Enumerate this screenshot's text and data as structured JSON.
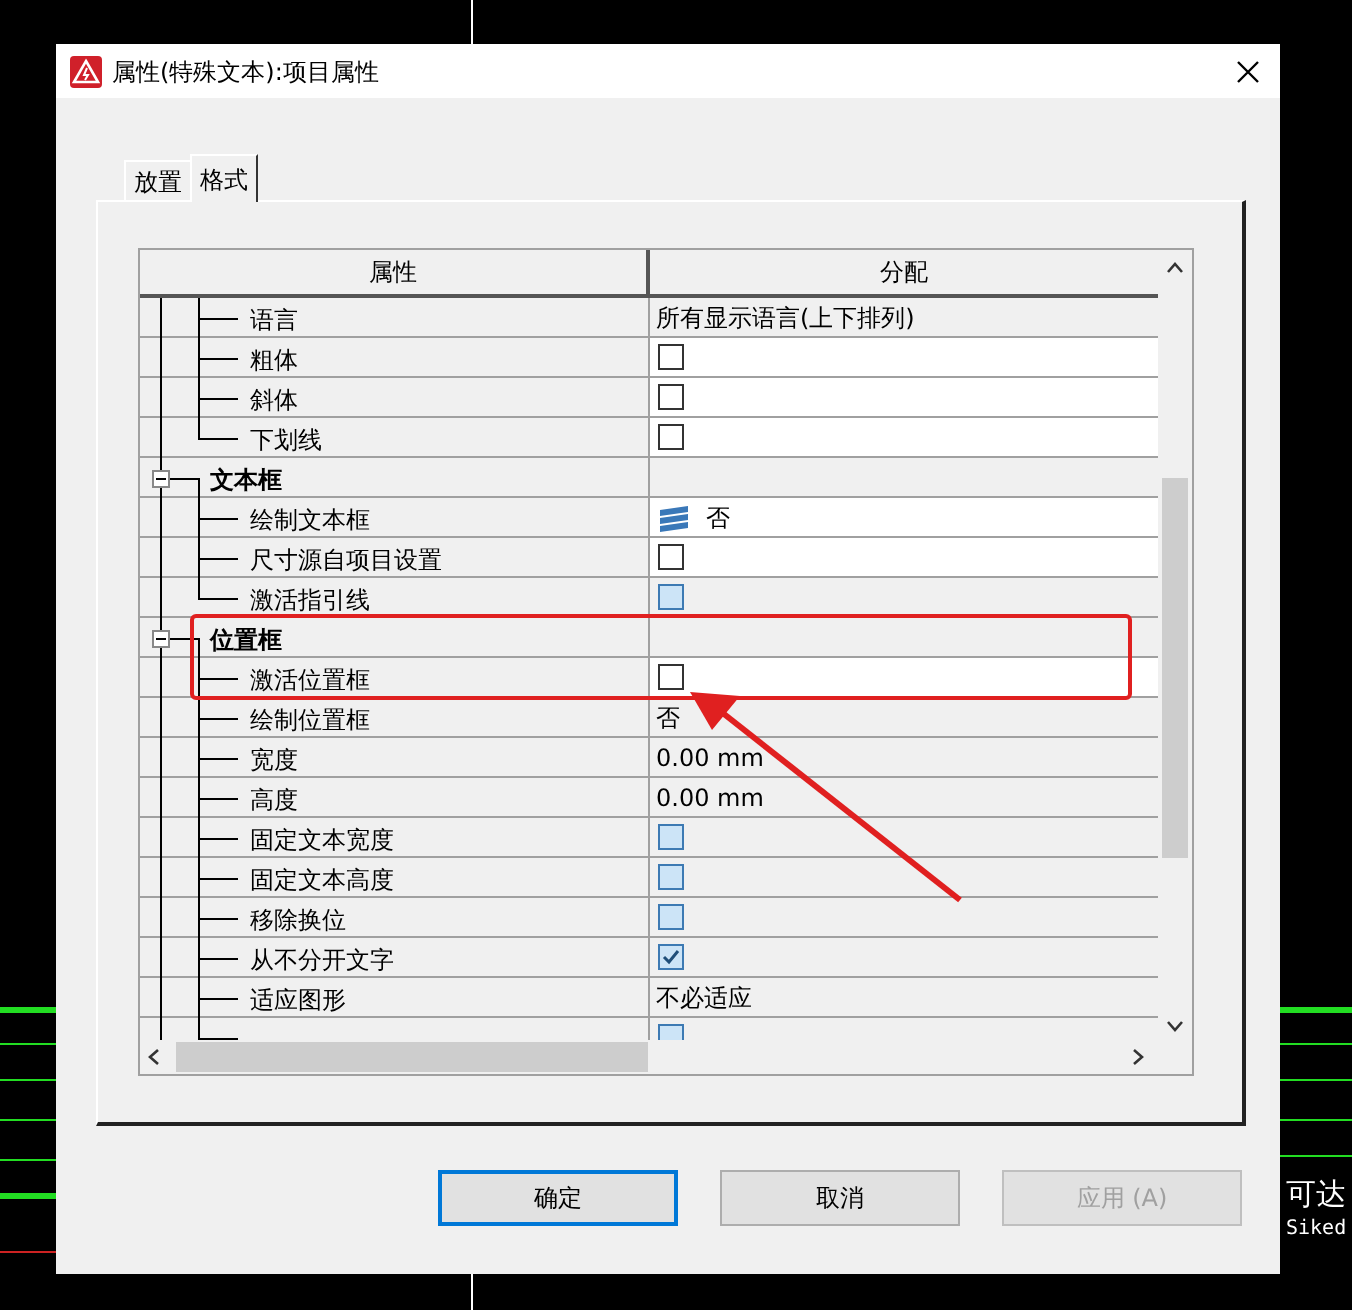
{
  "background": {
    "texts": [
      "可达",
      "Siked"
    ]
  },
  "window": {
    "title": "属性(特殊文本):项目属性"
  },
  "tabs": [
    {
      "label": "放置",
      "selected": false
    },
    {
      "label": "格式",
      "selected": true
    }
  ],
  "grid": {
    "columns": [
      "属性",
      "分配"
    ],
    "tree": [
      {
        "kind": "continued",
        "children": [
          {
            "label": "语言",
            "kind": "text",
            "value": "所有显示语言(上下排列)",
            "editable": false
          },
          {
            "label": "粗体",
            "kind": "checkbox",
            "checked": false,
            "editable": true
          },
          {
            "label": "斜体",
            "kind": "checkbox",
            "checked": false,
            "editable": true
          },
          {
            "label": "下划线",
            "kind": "checkbox",
            "checked": false,
            "editable": true
          }
        ]
      },
      {
        "kind": "group",
        "label": "文本框",
        "expanded": true,
        "children": [
          {
            "label": "绘制文本框",
            "kind": "icon_text",
            "value": "否",
            "editable": true
          },
          {
            "label": "尺寸源自项目设置",
            "kind": "checkbox",
            "checked": false,
            "editable": true
          },
          {
            "label": "激活指引线",
            "kind": "checkbox",
            "checked": false,
            "editable": false
          }
        ]
      },
      {
        "kind": "group",
        "label": "位置框",
        "expanded": true,
        "children": [
          {
            "label": "激活位置框",
            "kind": "checkbox",
            "checked": false,
            "editable": true
          },
          {
            "label": "绘制位置框",
            "kind": "text",
            "value": "否",
            "editable": false
          },
          {
            "label": "宽度",
            "kind": "text",
            "value": "0.00 mm",
            "editable": false
          },
          {
            "label": "高度",
            "kind": "text",
            "value": "0.00 mm",
            "editable": false
          },
          {
            "label": "固定文本宽度",
            "kind": "checkbox",
            "checked": false,
            "editable": false
          },
          {
            "label": "固定文本高度",
            "kind": "checkbox",
            "checked": false,
            "editable": false
          },
          {
            "label": "移除换位",
            "kind": "checkbox",
            "checked": false,
            "editable": false
          },
          {
            "label": "从不分开文字",
            "kind": "checkbox",
            "checked": true,
            "editable": false
          },
          {
            "label": "适应图形",
            "kind": "text",
            "value": "不必适应",
            "editable": false
          },
          {
            "kind": "checkbox",
            "checked": false,
            "editable": false
          }
        ]
      }
    ]
  },
  "buttons": [
    {
      "label": "确定",
      "default": true,
      "disabled": false
    },
    {
      "label": "取消",
      "default": false,
      "disabled": false
    },
    {
      "label": "应用 (A)",
      "default": false,
      "disabled": true
    }
  ]
}
